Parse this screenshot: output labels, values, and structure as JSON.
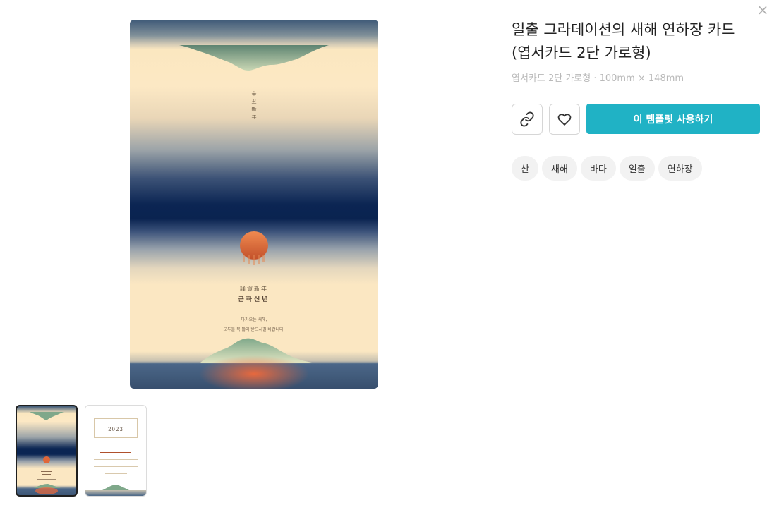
{
  "dialog": {
    "close_label": "×"
  },
  "card_preview": {
    "vertical_text": "辛丑新年",
    "hanja_title": "謹賀新年",
    "korean_title": "근하신년",
    "message_line1": "다가오는 새해,",
    "message_line2": "모두들 복 많이 받으시길 바랍니다."
  },
  "thumbnails": {
    "back_year": "2023"
  },
  "product": {
    "title": "일출 그라데이션의 새해 연하장 카드 (엽서카드 2단 가로형)",
    "subtitle": "엽서카드 2단 가로형 · 100mm × 148mm"
  },
  "actions": {
    "link_icon": "link-icon",
    "like_icon": "heart-icon",
    "use_template_label": "이 템플릿 사용하기"
  },
  "tags": [
    "산",
    "새해",
    "바다",
    "일출",
    "연하장"
  ],
  "colors": {
    "accent": "#20b2c5",
    "navy": "#0b2553",
    "cream": "#fbe7c2",
    "sun": "#e0673a",
    "mountain": "#8db08a"
  }
}
